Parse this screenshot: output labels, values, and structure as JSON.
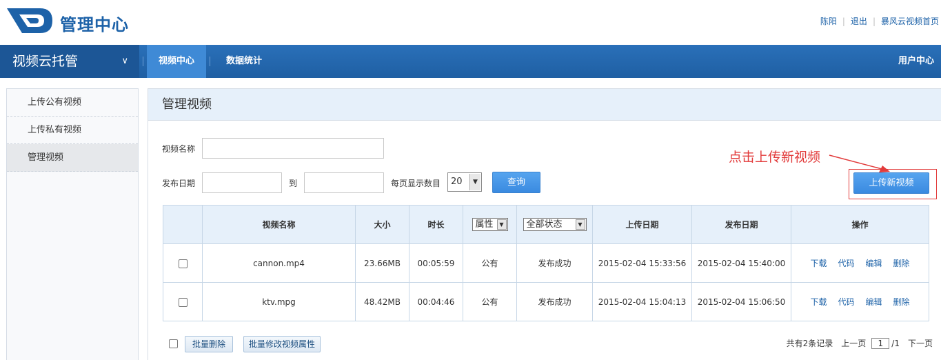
{
  "app": {
    "title": "管理中心"
  },
  "top_links": {
    "user": "陈阳",
    "logout": "退出",
    "home": "暴风云视频首页"
  },
  "nav": {
    "brand": "视频云托管",
    "tabs": [
      "视频中心",
      "数据统计"
    ],
    "user_center": "用户中心"
  },
  "sidebar": {
    "items": [
      {
        "label": "上传公有视频"
      },
      {
        "label": "上传私有视频"
      },
      {
        "label": "管理视频"
      }
    ]
  },
  "main": {
    "title": "管理视频"
  },
  "form": {
    "name_label": "视频名称",
    "date_label": "发布日期",
    "to_label": "到",
    "per_page_label": "每页显示数目",
    "per_page_value": "20",
    "query_button": "查询",
    "upload_button": "上传新视频",
    "annotation": "点击上传新视频"
  },
  "table": {
    "headers": [
      "视频名称",
      "大小",
      "时长",
      "属性",
      "全部状态",
      "上传日期",
      "发布日期",
      "操作"
    ],
    "rows": [
      {
        "name": "cannon.mp4",
        "size": "23.66MB",
        "duration": "00:05:59",
        "attr": "公有",
        "status": "发布成功",
        "upload": "2015-02-04 15:33:56",
        "publish": "2015-02-04 15:40:00"
      },
      {
        "name": "ktv.mpg",
        "size": "48.42MB",
        "duration": "00:04:46",
        "attr": "公有",
        "status": "发布成功",
        "upload": "2015-02-04 15:04:13",
        "publish": "2015-02-04 15:06:50"
      }
    ],
    "ops": [
      "下载",
      "代码",
      "编辑",
      "删除"
    ]
  },
  "footer": {
    "batch_delete": "批量删除",
    "batch_modify": "批量修改视频属性",
    "total": "共有2条记录",
    "prev": "上一页",
    "page": "1",
    "page_total": "/1",
    "next": "下一页"
  },
  "colors": {
    "brand_blue": "#1d62a8",
    "nav_bg": "#2a70b9",
    "nav_active": "#3f8ad6",
    "annotation_red": "#e23b3b"
  }
}
